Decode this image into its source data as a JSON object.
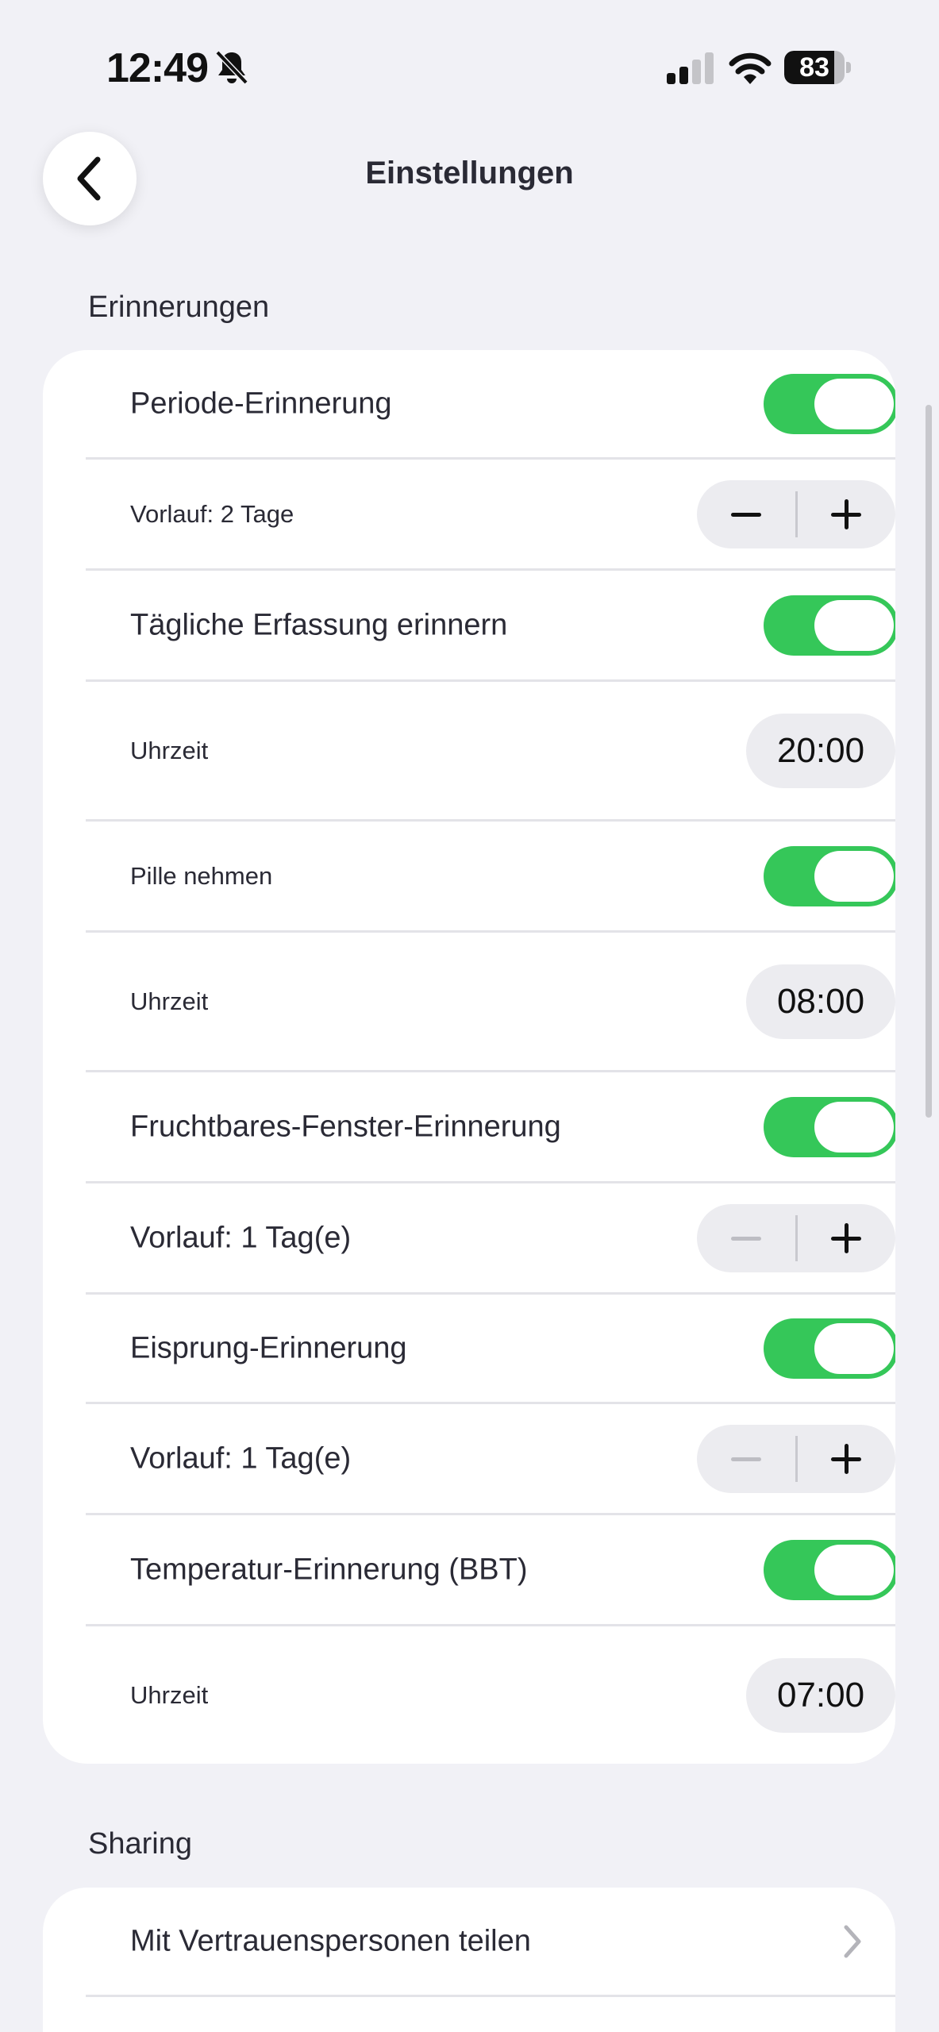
{
  "status_bar": {
    "time": "12:49",
    "battery": "83",
    "battery_level": 0.83,
    "icons": [
      "bell-slash-icon",
      "signal-icon",
      "wifi-icon",
      "battery-icon"
    ]
  },
  "nav": {
    "title": "Einstellungen",
    "back_icon": "chevron-left-icon"
  },
  "sections": {
    "reminders": {
      "title": "Erinnerungen",
      "rows": [
        {
          "label": "Periode-Erinnerung",
          "control": "toggle",
          "on": true
        },
        {
          "label": "Vorlauf: 2 Tage",
          "control": "stepper",
          "minus_enabled": true
        },
        {
          "label": "Tägliche Erfassung erinnern",
          "control": "toggle",
          "on": true
        },
        {
          "label": "Uhrzeit",
          "control": "time",
          "value": "20:00"
        },
        {
          "label": "Pille nehmen",
          "control": "toggle",
          "on": true
        },
        {
          "label": "Uhrzeit",
          "control": "time",
          "value": "08:00"
        },
        {
          "label": "Fruchtbares-Fenster-Erinnerung",
          "control": "toggle",
          "on": true
        },
        {
          "label": "Vorlauf: 1 Tag(e)",
          "control": "stepper",
          "minus_enabled": false
        },
        {
          "label": "Eisprung-Erinnerung",
          "control": "toggle",
          "on": true
        },
        {
          "label": "Vorlauf: 1 Tag(e)",
          "control": "stepper",
          "minus_enabled": false
        },
        {
          "label": "Temperatur-Erinnerung (BBT)",
          "control": "toggle",
          "on": true
        },
        {
          "label": "Uhrzeit",
          "control": "time",
          "value": "07:00"
        }
      ]
    },
    "sharing": {
      "title": "Sharing",
      "rows": [
        {
          "label": "Mit Vertrauenspersonen teilen",
          "control": "chevron"
        }
      ]
    }
  },
  "colors": {
    "background": "#f1f1f6",
    "toggle_on": "#35c759",
    "card": "#ffffff"
  }
}
